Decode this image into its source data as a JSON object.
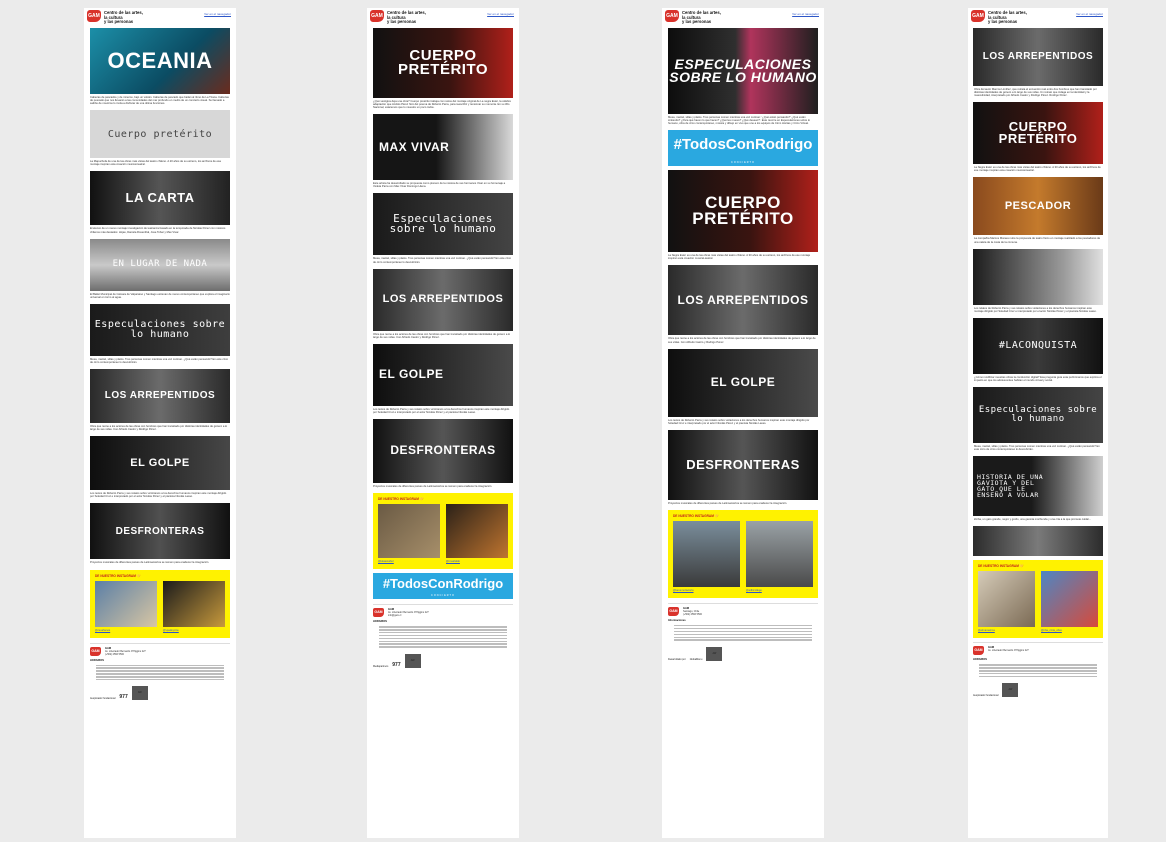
{
  "header": {
    "org_name": "Centro de las artes,\nla cultura\ny las personas",
    "web_link": "Ver en el navegador",
    "logo_text": "GAM"
  },
  "columns": [
    {
      "banners": [
        {
          "text": "OCEANIA",
          "caption": "Cabezas de pescados y de mineros, bajo un volcán. Cabezas de pescado que bailan al ritmo de La Tirana. Cabezas de pescado que nos llevarán a las comunidades del mar profundo en medio de un concierto visual. Su llamado a salir/te de nosotros lo invita a disfrutar de una última funciones."
        },
        {
          "text": "Cuerpo pretérito",
          "caption": "La Mapuchefa de una de las obras más vistas del teatro chileno. A 20 años de su estreno, los archivos de esa montaje inspiran esta creación musical-teatral."
        },
        {
          "text": "LA CARTA",
          "caption": "El elenco de un nuevo montaje investigación de teatranza basado en la temporada de Nicolás Pérez con músicos chilenos más destados: Hojas, Daniela Rosenthal, Jose Tobar y Max Vivar."
        },
        {
          "text": "EN LUGAR DE NADA",
          "caption": "El Ballet Municipal de Cámara de Valparaíso y Santiago estrenan de nuevo contemporáneo que explora el imaginario universal en torno al agua."
        },
        {
          "text": "Especulaciones sobre lo humano",
          "caption": "Mesa, mantel, sillas y platos. Tres personas comen mientras una vez cocinan. ¿Qué están pensando? En este circo de circo contemporáneo lo descubrirán."
        },
        {
          "text": "LOS ARREPENTIDOS",
          "caption": "Obra que reúne a los actores de las obras con hombres que han transitado por distintas identidades de género a lo largo de sus vidas. Con Alfredo Castro y Rodrigo Pérez."
        },
        {
          "text": "EL GOLPE",
          "caption": "Los textos de Roberto Parra y sus relatos sobre victorianos a los derechos humanos inspiran este montaje dirigido por Soledad Cruz e interpretado por el actor Nicolás Pérez y el pianista Nicolás Lasso."
        },
        {
          "text": "DESFRONTERAS",
          "caption": "Proyectos musicales de diferentes países de Latinoamérica se reúnen para enaltecer la integración."
        }
      ],
      "instagram": {
        "title": "DE NUESTRO INSTAGRAM 💛",
        "handles": [
          "@cevahanos",
          "@vpadeycine"
        ]
      }
    },
    {
      "banners": [
        {
          "text": "CUERPO PRETÉRITO",
          "caption": "¿Qué vestigios deja una obra? Cuerpo pretérito trabaja con restos del montaje original de La negra Ester, la célebre adaptación que Andrés Pérez hizo del poema de Roberto Parra, para reescribir y tensionar su memoria. En su 30o Nacional, estaremos que lo muestre un poco todos."
        },
        {
          "text": "MAX VIVAR",
          "caption": "Este artista ha desarrollado su propuesta como pionero de la música de sus hermanos Vivar en su homenaje a Violeta Parra con Max Vivar Domingo Hiena."
        },
        {
          "text": "Especulaciones sobre lo humano",
          "caption": "Mesa, mantel, sillas y platos. Tres personas comen mientras una vez cocinan. ¿Qué están pensando? En este circo de circo contemporáneo lo descubrirán."
        },
        {
          "text": "LOS ARREPENTIDOS",
          "caption": "Obra que reúne a los actores de las obras con hombres que han transitado por distintas identidades de género a lo largo de sus vidas. Con Alfredo Castro y Rodrigo Pérez."
        },
        {
          "text": "EL GOLPE",
          "caption": "Los textos de Roberto Parra y sus relatos sobre victorianos a los derechos humanos inspiran este montaje dirigido por Soledad Cruz e interpretado por el actor Nicolás Pérez y el pianista Nicolás Lasso."
        },
        {
          "text": "DESFRONTERAS",
          "caption": "Proyectos musicales de diferentes países de Latinoamérica se reúnen para enaltecer la integración."
        }
      ],
      "instagram": {
        "title": "DE NUESTRO INSTAGRAM 💛",
        "handles": [
          "@lukasnuñez",
          "@mvarlaldo"
        ]
      },
      "hashtag": "#TodosConRodrigo"
    },
    {
      "banners": [
        {
          "text": "ESPECULACIONES SOBRE LO HUMANO",
          "caption": "Mesa, mantel, sillas y platos. Tres personas comen mientras una vez cocinan: '¿Qué están pensando?' ¿Qué están sintiendo? ¿Para qué hacen lo que hacen? ¿Qué les mueve? ¿Qué desean?'. Este recorre en Especulaciones sobre lo humano, obra de circo contemporáneo, música y dibujo en vivo que une a los equipos de Circo Horitas y Circo Virtual."
        },
        {
          "text": "#TodosConRodrigo",
          "caption": ""
        },
        {
          "text": "CUERPO PRETÉRITO",
          "caption": "La Negra Ester es una de las obras más vistas del teatro chileno. A 30 años de su estreno, los archivos de ese montaje inspiran esta creación musical-teatral."
        },
        {
          "text": "LOS ARREPENTIDOS",
          "caption": "Obra que reúne a los actores de las obras con hombres que han transitado por distintas identidades de género a lo largo de sus vidas. Con Alfredo Castro y Rodrigo Pérez."
        },
        {
          "text": "EL GOLPE",
          "caption": "Los textos de Roberto Parra y sus relatos sobre violaciones a los derechos humanos inspiran este montaje dirigido por Soledad Cruz e interpretado por el actor Nicolás Pérez y el pianista Nicolás Lasso."
        },
        {
          "text": "DESFRONTERAS",
          "caption": "Proyectos musicales de diferentes países de Latinoamérica se reúnen para enaltecer la integración."
        }
      ],
      "instagram": {
        "title": "DE NUESTRO INSTAGRAM 💛",
        "handles": [
          "@lamemoriacorta",
          "@adbicollege"
        ]
      }
    },
    {
      "banners": [
        {
          "text": "LOS ARREPENTIDOS",
          "caption": "Obra del autor Marcos Limiñez, que retrata el encuentro real entre dos hombres que han transitado por distintas identidades de género a lo largo de sus vidas. Un retrato que indaga en la identidad y la masculinidad, interpretado por Alfredo Castro y Rodrigo Pérez. Rodrigo Pérez."
        },
        {
          "text": "CUERPO PRETÉRITO",
          "caption": "La Negra Ester es una de las obras más vistas del teatro chileno. A 30 años de su estreno, los archivos de ese montaje inspiran esta creación musical-teatral."
        },
        {
          "text": "PESCADOR",
          "caption": "La compañía Marcos Moraes nutre la propuesta de teatro físico en montaje realizado a los pescadores de una caleta de la costa de la comuna."
        },
        {
          "text": "",
          "caption": "Los relatos de Roberto Parra y sus relatos sobre violaciones a los derechos humanos inspiran este montaje dirigido por Soledad Cruz e interpretado por el actor Nicolás Pérez y el pianista Nicolás Lasso."
        },
        {
          "text": "#LACONQUISTA",
          "caption": "¿Cómo modificar nuestras obras la conducción digital? Esa pregunta guía esta performance que explora el impacto en que los adolescentes habitan el mundo virtual y social."
        },
        {
          "text": "Especulaciones sobre lo humano",
          "caption": "Mesa, mantel, sillas y platos. Tres personas comen mientras una vez cocinan. ¿Qué están pensando? En este circo de circo contemporáneo lo descubrirán."
        },
        {
          "text": "HISTORIA DE UNA GAVIOTA Y DEL GATO QUE LE ENSEÑÓ A VOLAR",
          "caption": "Zorba, un gato grande, negro y gordo, una gaviota moribunda y una cría a la que promete cuidar..."
        },
        {
          "text": "",
          "caption": ""
        }
      ],
      "instagram": {
        "title": "DE NUESTRO INSTAGRAM 💛",
        "handles": [
          "@elmanuelma",
          "@nba_cinta_cdes"
        ]
      }
    }
  ],
  "footer": {
    "name": "GAM",
    "address": "Av. Libertador Bernardo O'Higgins 227",
    "city": "Santiago, Chile",
    "phone": "(+562) 2566 5500",
    "email": "info@gam.cl",
    "schedule_title": "HORARIOS",
    "info_title": "Informaciones",
    "sponsors_label": "Auspiciador fundacional",
    "partners_label": "Mediapartners",
    "developed_label": "Desarrollado por",
    "aw": "AW",
    "num": "977",
    "studio": "GlobalRenu"
  }
}
